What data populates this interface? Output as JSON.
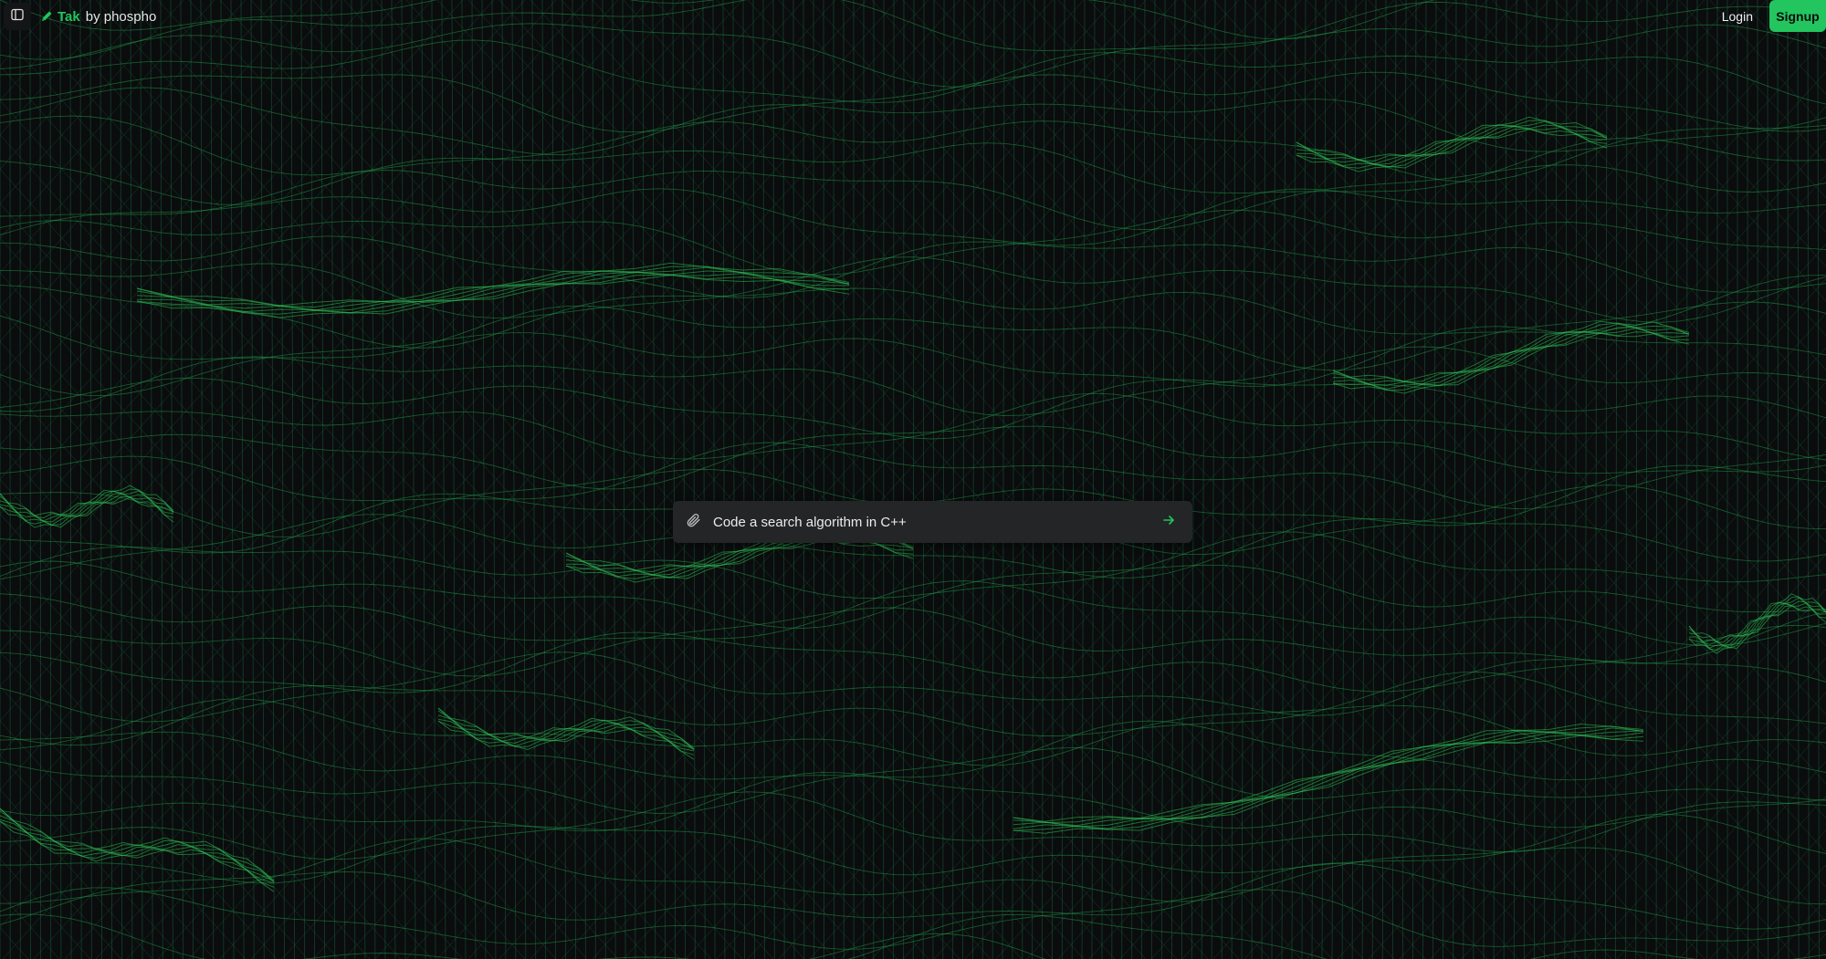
{
  "theme": {
    "background": "#0b0c0d",
    "accent": "#22c55e",
    "mesh_color": "#1f9d4a",
    "prompt_background": "#242526"
  },
  "header": {
    "sidebar_toggle_icon": "sidebar-panel-icon",
    "brand_icon": "pen-icon",
    "brand_name": "Tak",
    "brand_suffix": "by phospho",
    "login_label": "Login",
    "signup_label": "Signup"
  },
  "prompt": {
    "attach_icon": "paperclip-icon",
    "placeholder": "Code a search algorithm in C++",
    "value": "",
    "send_icon": "arrow-right-icon"
  },
  "background": {
    "type": "wireframe-wave-mesh"
  }
}
